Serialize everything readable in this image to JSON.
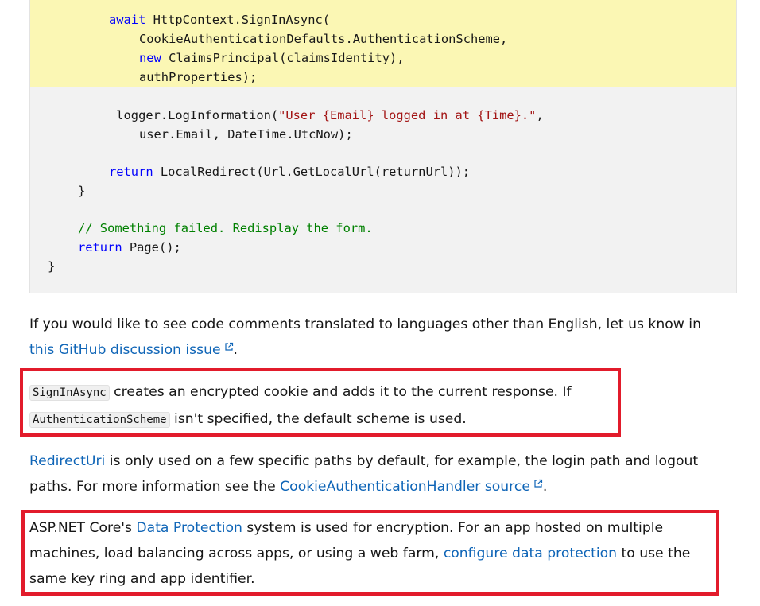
{
  "code": {
    "line1": {
      "kw": "await",
      "rest": " HttpContext.SignInAsync("
    },
    "line2": {
      "text": "CookieAuthenticationDefaults.AuthenticationScheme,"
    },
    "line3": {
      "kw": "new",
      "rest": " ClaimsPrincipal(claimsIdentity),"
    },
    "line4": {
      "text": "authProperties);"
    },
    "line5": {
      "pre": "_logger.LogInformation(",
      "str": "\"User {Email} logged in at {Time}.\"",
      "post": ","
    },
    "line6": {
      "text": "user.Email, DateTime.UtcNow);"
    },
    "line7": {
      "kw": "return",
      "rest": " LocalRedirect(Url.GetLocalUrl(returnUrl));"
    },
    "line8": {
      "text": "}"
    },
    "line9": {
      "comment": "// Something failed. Redisplay the form."
    },
    "line10": {
      "kw": "return",
      "rest": " Page();"
    },
    "line11": {
      "text": "}"
    }
  },
  "para1": {
    "text": "If you would like to see code comments translated to languages other than English, let us know in",
    "link": "this GitHub discussion issue",
    "end": "."
  },
  "para2": {
    "code1": "SignInAsync",
    "text1": " creates an encrypted cookie and adds it to the current response. If",
    "code2": "AuthenticationScheme",
    "text2": " isn't specified, the default scheme is used."
  },
  "para3": {
    "link1": "RedirectUri",
    "text1": " is only used on a few specific paths by default, for example, the login path and logout",
    "text2": "paths. For more information see the ",
    "link2": "CookieAuthenticationHandler source",
    "end": "."
  },
  "para4": {
    "text1": "ASP.NET Core's ",
    "link1": "Data Protection",
    "text2": " system is used for encryption. For an app hosted on multiple",
    "text3": "machines, load balancing across apps, or using a web farm, ",
    "link2": "configure data protection",
    "text4": " to use the",
    "text5": "same key ring and app identifier."
  },
  "colors": {
    "highlight": "#fbf7b4",
    "code_bg": "#f2f2f2",
    "link": "#0f65b7",
    "annotation_border": "#e21b2b",
    "keyword": "#0101fd",
    "string": "#a31515",
    "comment": "#008000"
  }
}
